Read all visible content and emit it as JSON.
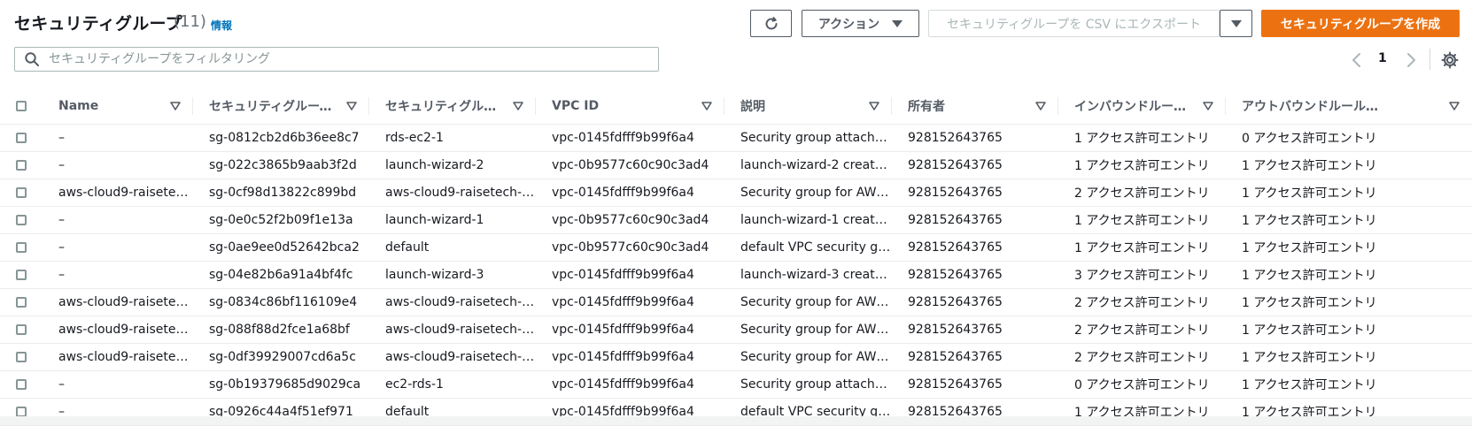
{
  "header": {
    "title": "セキュリティグループ",
    "count": "(11)",
    "info": "情報"
  },
  "toolbar": {
    "actions_label": "アクション",
    "export_label": "セキュリティグループを CSV にエクスポート",
    "create_label": "セキュリティグループを作成"
  },
  "search": {
    "placeholder": "セキュリティグループをフィルタリング"
  },
  "pagination": {
    "current_page": "1"
  },
  "table": {
    "columns": [
      "Name",
      "セキュリティグループ…",
      "セキュリティグルー…",
      "VPC ID",
      "説明",
      "所有者",
      "インバウンドルール…",
      "アウトバウンドルール…"
    ],
    "rows": [
      [
        "–",
        "sg-0812cb2d6b36ee8c7",
        "rds-ec2-1",
        "vpc-0145fdfff9b99f6a4",
        "Security group attache…",
        "928152643765",
        "1 アクセス許可エントリ",
        "0 アクセス許可エントリ"
      ],
      [
        "–",
        "sg-022c3865b9aab3f2d",
        "launch-wizard-2",
        "vpc-0b9577c60c90c3ad4",
        "launch-wizard-2 create…",
        "928152643765",
        "1 アクセス許可エントリ",
        "1 アクセス許可エントリ"
      ],
      [
        "aws-cloud9-raisete…",
        "sg-0cf98d13822c899bd",
        "aws-cloud9-raisetech-l…",
        "vpc-0145fdfff9b99f6a4",
        "Security group for AW…",
        "928152643765",
        "2 アクセス許可エントリ",
        "1 アクセス許可エントリ"
      ],
      [
        "–",
        "sg-0e0c52f2b09f1e13a",
        "launch-wizard-1",
        "vpc-0b9577c60c90c3ad4",
        "launch-wizard-1 create…",
        "928152643765",
        "1 アクセス許可エントリ",
        "1 アクセス許可エントリ"
      ],
      [
        "–",
        "sg-0ae9ee0d52642bca2",
        "default",
        "vpc-0b9577c60c90c3ad4",
        "default VPC security gr…",
        "928152643765",
        "1 アクセス許可エントリ",
        "1 アクセス許可エントリ"
      ],
      [
        "–",
        "sg-04e82b6a91a4bf4fc",
        "launch-wizard-3",
        "vpc-0145fdfff9b99f6a4",
        "launch-wizard-3 create…",
        "928152643765",
        "3 アクセス許可エントリ",
        "1 アクセス許可エントリ"
      ],
      [
        "aws-cloud9-raisete…",
        "sg-0834c86bf116109e4",
        "aws-cloud9-raisetech-l…",
        "vpc-0145fdfff9b99f6a4",
        "Security group for AW…",
        "928152643765",
        "2 アクセス許可エントリ",
        "1 アクセス許可エントリ"
      ],
      [
        "aws-cloud9-raisete…",
        "sg-088f88d2fce1a68bf",
        "aws-cloud9-raisetech-r…",
        "vpc-0145fdfff9b99f6a4",
        "Security group for AW…",
        "928152643765",
        "2 アクセス許可エントリ",
        "1 アクセス許可エントリ"
      ],
      [
        "aws-cloud9-raisete…",
        "sg-0df39929007cd6a5c",
        "aws-cloud9-raisetech-l…",
        "vpc-0145fdfff9b99f6a4",
        "Security group for AW…",
        "928152643765",
        "2 アクセス許可エントリ",
        "1 アクセス許可エントリ"
      ],
      [
        "–",
        "sg-0b19379685d9029ca",
        "ec2-rds-1",
        "vpc-0145fdfff9b99f6a4",
        "Security group attache…",
        "928152643765",
        "0 アクセス許可エントリ",
        "1 アクセス許可エントリ"
      ],
      [
        "–",
        "sg-0926c44a4f51ef971",
        "default",
        "vpc-0145fdfff9b99f6a4",
        "default VPC security gr…",
        "928152643765",
        "1 アクセス許可エントリ",
        "1 アクセス許可エントリ"
      ]
    ]
  },
  "colors": {
    "link": "#0073bb",
    "primary_button": "#ec7211",
    "text": "#16191f",
    "muted": "#545b64"
  }
}
